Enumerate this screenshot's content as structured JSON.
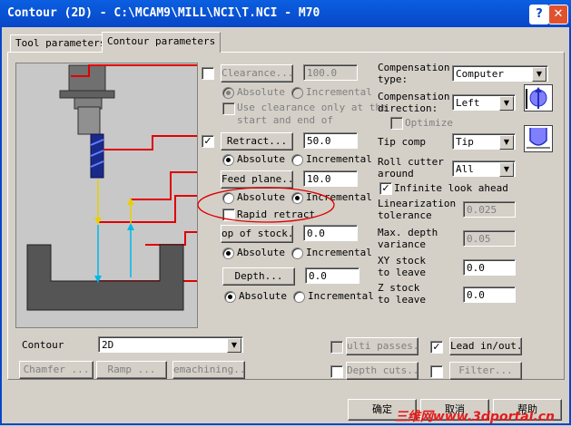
{
  "window": {
    "title": "Contour (2D) - C:\\MCAM9\\MILL\\NCI\\T.NCI - M70",
    "help_glyph": "?",
    "close_glyph": "✕"
  },
  "tabs": [
    "Tool parameters",
    "Contour parameters"
  ],
  "left": {
    "clearance": {
      "label": "Clearance...",
      "value": "100.0",
      "checked": false
    },
    "clearance_mode": {
      "absolute": "Absolute",
      "incremental": "Incremental"
    },
    "clearance_start_end": "Use clearance only at the\nstart and end of",
    "retract": {
      "label": "Retract...",
      "value": "50.0",
      "checked": "✓"
    },
    "retract_mode": {
      "absolute": "Absolute",
      "incremental": "Incremental"
    },
    "feed_plane": {
      "label": "Feed plane...",
      "value": "10.0"
    },
    "feed_mode": {
      "absolute": "Absolute",
      "incremental": "Incremental"
    },
    "rapid_retract": "Rapid retract",
    "top_of_stock": {
      "label": "op of stock..",
      "value": "0.0"
    },
    "stock_mode": {
      "absolute": "Absolute",
      "incremental": "Incremental"
    },
    "depth": {
      "label": "Depth...",
      "value": "0.0"
    },
    "depth_mode": {
      "absolute": "Absolute",
      "incremental": "Incremental"
    }
  },
  "right": {
    "compensation_type": {
      "label": "Compensation\ntype:",
      "value": "Computer"
    },
    "compensation_direction": {
      "label": "Compensation\ndirection:",
      "value": "Left"
    },
    "optimize": "Optimize",
    "tip_comp": {
      "label": "Tip comp",
      "value": "Tip"
    },
    "roll_cutter": {
      "label": "Roll cutter\naround",
      "value": "All"
    },
    "infinite_look_ahead": {
      "label": "Infinite look ahead",
      "checked": "✓"
    },
    "linearization": {
      "label": "Linearization\ntolerance",
      "value": "0.025"
    },
    "max_depth_variance": {
      "label": "Max. depth\nvariance",
      "value": "0.05"
    },
    "xy_stock": {
      "label": "XY stock\nto leave",
      "value": "0.0"
    },
    "z_stock": {
      "label": "Z stock\nto leave",
      "value": "0.0"
    }
  },
  "bottom": {
    "contour_label": "Contour",
    "contour_value": "2D",
    "chamfer": "Chamfer ...",
    "ramp": "Ramp ...",
    "remachining": "emachining...",
    "multi_passes": "ulti passes...",
    "lead_in_out": "Lead in/out...",
    "depth_cuts": "Depth cuts...",
    "filter": "Filter..."
  },
  "footer": {
    "ok": "确定",
    "cancel": "取消",
    "help": "帮助",
    "watermark": "三维网www.3dportal.cn"
  },
  "colors": {
    "titlebar": "#0846c8",
    "dialog": "#d4d0c8",
    "guide_red": "#e00000",
    "tool_blue": "#1a2a8a"
  }
}
